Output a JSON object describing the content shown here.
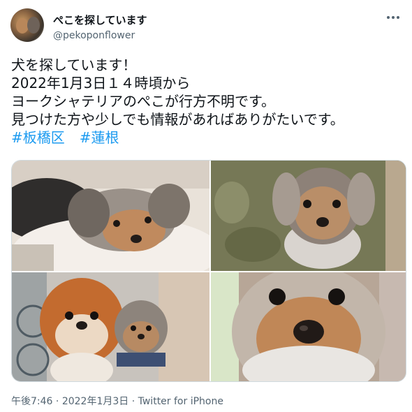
{
  "tweet": {
    "display_name": "ぺこを探しています",
    "handle": "@pekoponflower",
    "lines": [
      "犬を探しています！",
      "2022年1月3日１４時頃から",
      "ヨークシャテリアのぺこが行方不明です。",
      "見つけた方や少しでも情報があればありがたいです。"
    ],
    "hashtags": [
      "#板橋区",
      "#蓮根"
    ],
    "time": "午後7:46",
    "date": "2022年1月3日",
    "source": "Twitter for iPhone"
  },
  "icons": {
    "avatar": "profile-photo-dogs",
    "more": "more-horizontal-icon"
  },
  "colors": {
    "link": "#1d9bf0",
    "secondary_text": "#536471",
    "primary_text": "#0f1419",
    "border": "#cfd9de"
  },
  "media": {
    "photos": [
      {
        "subject": "yorkie-lying-on-cushion"
      },
      {
        "subject": "yorkie-sitting-on-green-rug"
      },
      {
        "subject": "pomeranian-and-yorkie-held"
      },
      {
        "subject": "yorkie-closeup-face"
      }
    ]
  }
}
